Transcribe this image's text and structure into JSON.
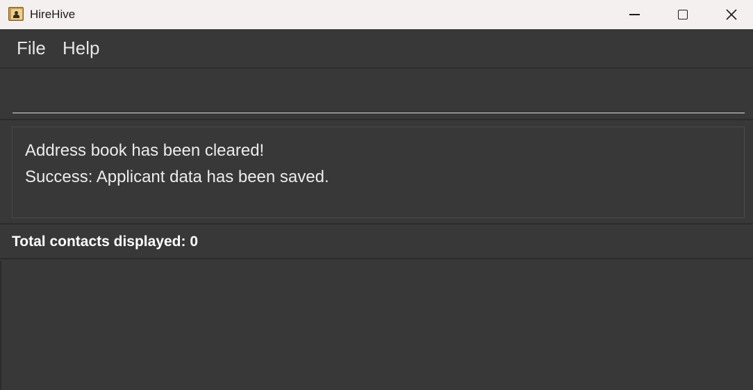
{
  "window": {
    "title": "HireHive",
    "icon": "address-book-icon"
  },
  "menu": {
    "items": [
      {
        "label": "File"
      },
      {
        "label": "Help"
      }
    ]
  },
  "command": {
    "value": "",
    "placeholder": ""
  },
  "result": {
    "lines": [
      "Address book has been cleared!",
      "Success: Applicant data has been saved."
    ]
  },
  "status": {
    "text": "Total contacts displayed: 0"
  },
  "colors": {
    "background": "#383838",
    "titlebar": "#f5f0f0",
    "text": "#ececec"
  }
}
